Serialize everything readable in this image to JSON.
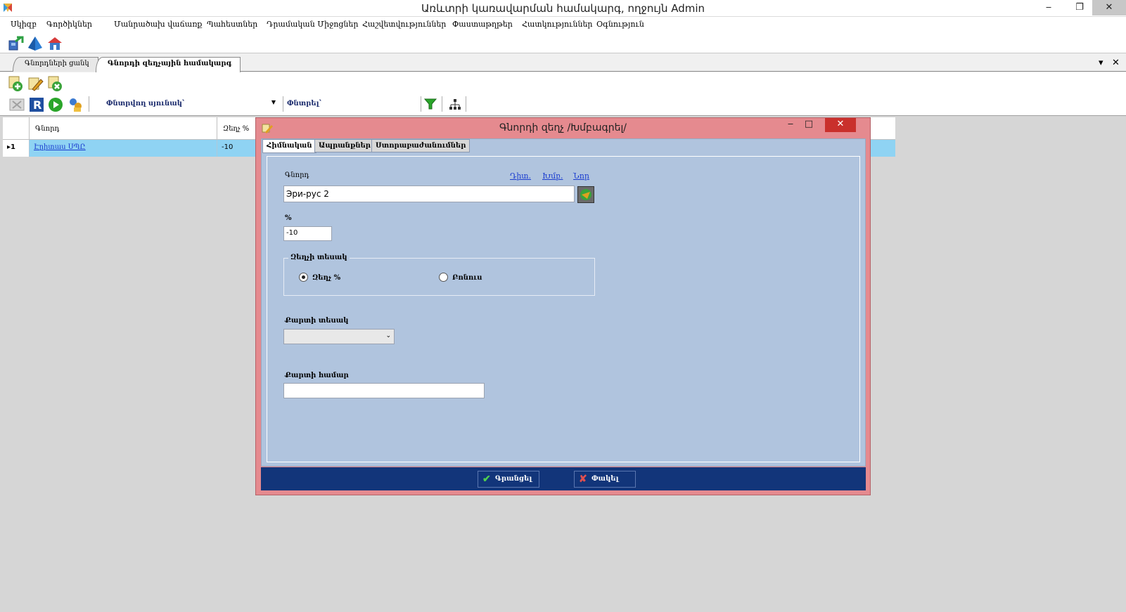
{
  "window": {
    "title": "Առևտրի կառավարման համակարգ, ողջույն Admin",
    "min": "‒",
    "restore": "❐",
    "close": "✕"
  },
  "menu": [
    "Սկիզբ",
    "Գործիկներ",
    "Մանրածախ վաճառք",
    "Պահեստներ",
    "Դրամական Միջոցներ",
    "Հաշվետվություններ",
    "Փաստաթղթեր",
    "Հատկություններ",
    "Օգնություն"
  ],
  "tabs": {
    "list": "Գնորդների ցանկ",
    "active": "Գնորդի զեղչային համակարգ",
    "dropdown": "▾",
    "close": "✕"
  },
  "search": {
    "column_label": "Փնտրվող սյունակ՝",
    "search_label": "Փնտրել՝",
    "column_value": "",
    "search_value": ""
  },
  "grid": {
    "headers": [
      "Գնորդ",
      "Զեղչ %"
    ],
    "rows": [
      {
        "marker": "▸1",
        "buyer": "Էրիտաս ՍՊԸ",
        "discount": "-10"
      }
    ]
  },
  "dialog": {
    "title": "Գնորդի զեղչ /Խմբագրել/",
    "min": "‒",
    "max": "□",
    "close": "✕",
    "tabs": [
      "Հիմնական",
      "Ապրանքներ",
      "Ստորաբաժանումներ"
    ],
    "buyer_label": "Գնորդ",
    "links": {
      "view": "Դիտ.",
      "edit": "Խմբ.",
      "new": "Նոր"
    },
    "buyer_value": "Эри-рус 2",
    "percent_label": "%",
    "percent_value": "-10",
    "discount_type": {
      "title": "Զեղչի տեսակ",
      "option1": "Զեղչ %",
      "option2": "Բոնուս",
      "selected": "Զեղչ %"
    },
    "card_type_label": "Քարտի տեսակ",
    "card_type_value": "",
    "card_number_label": "Քարտի համար",
    "card_number_value": "",
    "save": "Գրանցել",
    "cancel": "Փակել"
  },
  "colors": {
    "dialog_frame": "#e58a8f",
    "form_bg": "#b0c4de",
    "footer": "#12357a",
    "selected_row": "#8fd3f3"
  },
  "icons": [
    "app-logo-icon",
    "exchange-icon",
    "pyramid-icon",
    "house-icon",
    "add-icon",
    "edit-icon",
    "delete-icon",
    "disabled-x-icon",
    "refresh-icon",
    "play-icon",
    "users-icon",
    "filter-icon",
    "hierarchy-icon",
    "lookup-icon"
  ]
}
